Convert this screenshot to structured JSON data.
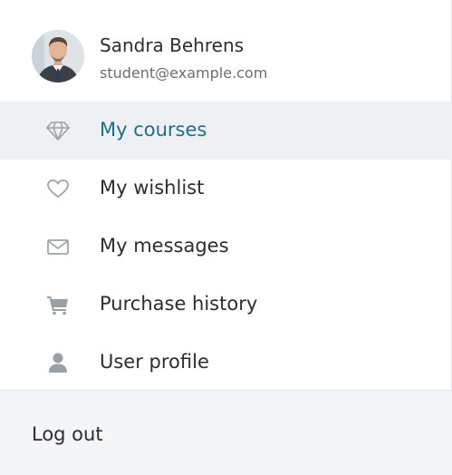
{
  "user": {
    "name": "Sandra Behrens",
    "email": "student@example.com"
  },
  "menu": {
    "items": [
      {
        "label": "My courses",
        "icon": "diamond-icon",
        "active": true
      },
      {
        "label": "My wishlist",
        "icon": "heart-icon",
        "active": false
      },
      {
        "label": "My messages",
        "icon": "envelope-icon",
        "active": false
      },
      {
        "label": "Purchase history",
        "icon": "cart-icon",
        "active": false
      },
      {
        "label": "User profile",
        "icon": "user-icon",
        "active": false
      }
    ]
  },
  "footer": {
    "logout_label": "Log out"
  },
  "colors": {
    "active_text": "#1b6e8f",
    "active_background": "#eef0f2",
    "icon": "#9aa0a6",
    "text": "#2b2d30",
    "footer_background": "#f4f5f6"
  }
}
